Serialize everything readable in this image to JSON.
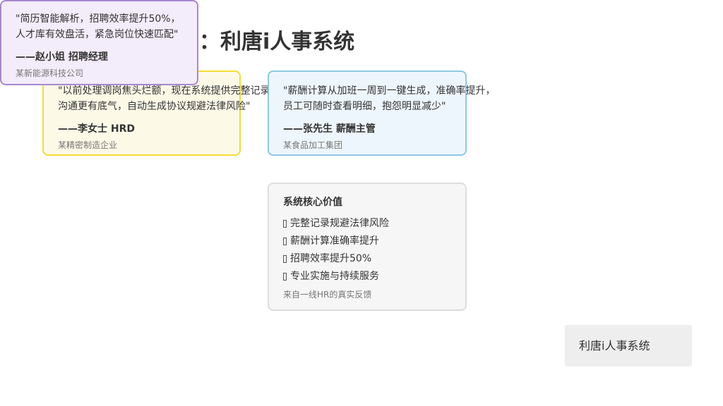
{
  "page": {
    "title_fragment": "：利唐i人事系统"
  },
  "testimonials": [
    {
      "quote_line1": "\"以前处理调岗焦头烂额，现在系统提供完整记录",
      "quote_line2": "沟通更有底气，自动生成协议规避法律风险\"",
      "author": "——李女士 HRD",
      "company": "某精密制造企业",
      "accent": "#f3dc33"
    },
    {
      "quote_line1": "\"薪酬计算从加班一周到一键生成，准确率提升，",
      "quote_line2": "员工可随时查看明细，抱怨明显减少\"",
      "author": "——张先生 薪酬主管",
      "company": "某食品加工集团",
      "accent": "#8cc9e4"
    },
    {
      "quote_line1": "\"简历智能解析，招聘效率提升50%，",
      "quote_line2": "人才库有效盘活，紧急岗位快速匹配\"",
      "author": "——赵小姐 招聘经理",
      "company": "某新能源科技公司",
      "accent": "#a887d0"
    }
  ],
  "core_value": {
    "title": "系统核心价值",
    "items": [
      "完整记录规避法律风险",
      "薪酬计算准确率提升",
      "招聘效率提升50%",
      "专业实施与持续服务"
    ],
    "footnote": "来自一线HR的真实反馈"
  },
  "app_tag": {
    "label": "利唐i人事系统"
  }
}
